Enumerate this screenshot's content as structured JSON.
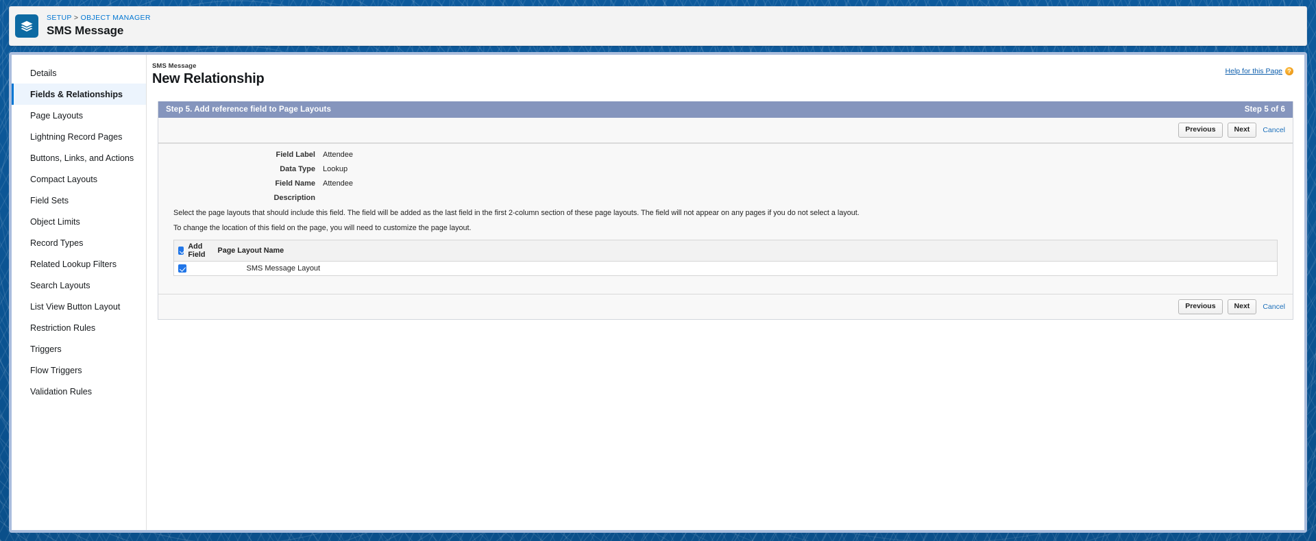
{
  "header": {
    "app_icon": "layers-stack-icon",
    "breadcrumb_setup": "SETUP",
    "breadcrumb_separator": ">",
    "breadcrumb_object_manager": "OBJECT MANAGER",
    "object_title": "SMS Message",
    "accent_color": "#0d6aa3",
    "link_color": "#0176d3"
  },
  "sidebar": {
    "items": [
      {
        "label": "Details",
        "active": false
      },
      {
        "label": "Fields & Relationships",
        "active": true
      },
      {
        "label": "Page Layouts",
        "active": false
      },
      {
        "label": "Lightning Record Pages",
        "active": false
      },
      {
        "label": "Buttons, Links, and Actions",
        "active": false
      },
      {
        "label": "Compact Layouts",
        "active": false
      },
      {
        "label": "Field Sets",
        "active": false
      },
      {
        "label": "Object Limits",
        "active": false
      },
      {
        "label": "Record Types",
        "active": false
      },
      {
        "label": "Related Lookup Filters",
        "active": false
      },
      {
        "label": "Search Layouts",
        "active": false
      },
      {
        "label": "List View Button Layout",
        "active": false
      },
      {
        "label": "Restriction Rules",
        "active": false
      },
      {
        "label": "Triggers",
        "active": false
      },
      {
        "label": "Flow Triggers",
        "active": false
      },
      {
        "label": "Validation Rules",
        "active": false
      }
    ]
  },
  "content": {
    "context_label": "SMS Message",
    "page_title": "New Relationship",
    "help_link": "Help for this Page",
    "help_icon": "question-mark-badge-icon"
  },
  "wizard": {
    "step_title": "Step 5. Add reference field to Page Layouts",
    "step_counter": "Step 5 of 6",
    "banner_color": "#8595bd",
    "buttons": {
      "previous": "Previous",
      "next": "Next",
      "cancel": "Cancel"
    },
    "fields": [
      {
        "label": "Field Label",
        "value": "Attendee"
      },
      {
        "label": "Data Type",
        "value": "Lookup"
      },
      {
        "label": "Field Name",
        "value": "Attendee"
      },
      {
        "label": "Description",
        "value": ""
      }
    ],
    "notes": [
      "Select the page layouts that should include this field. The field will be added as the last field in the first 2-column section of these page layouts. The field will not appear on any pages if you do not select a layout.",
      "To change the location of this field on the page, you will need to customize the page layout."
    ],
    "table": {
      "columns": [
        "Add Field",
        "Page Layout Name"
      ],
      "header_checkbox_checked": true,
      "rows": [
        {
          "checked": true,
          "name": "SMS Message Layout"
        }
      ]
    }
  }
}
